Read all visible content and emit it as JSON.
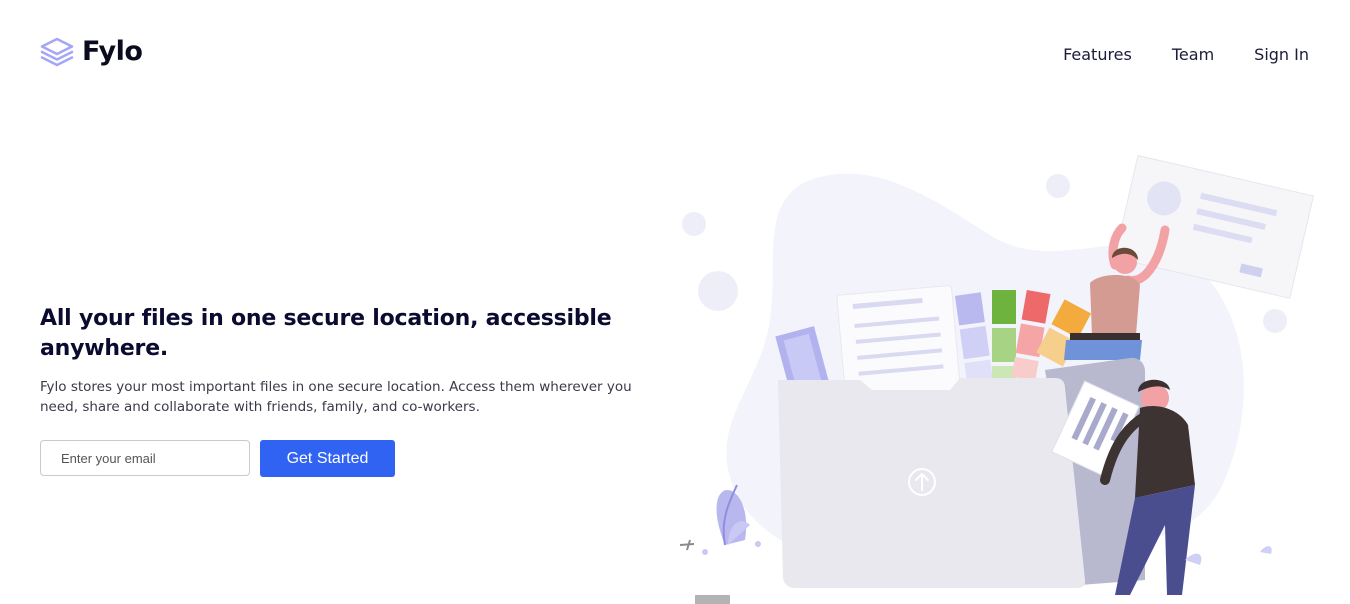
{
  "header": {
    "brand": "Fylo",
    "logo_icon": "stacked-layers-icon",
    "nav": [
      {
        "label": "Features"
      },
      {
        "label": "Team"
      },
      {
        "label": "Sign In"
      }
    ]
  },
  "hero": {
    "title": "All your files in one secure location, accessible anywhere.",
    "description": "Fylo stores your most important files in one secure location. Access them wherever you need, share and collaborate with friends, family, and co-workers."
  },
  "signup": {
    "email_placeholder": "Enter your email",
    "email_value": "",
    "button_label": "Get Started"
  },
  "illustration": {
    "name": "people-with-folder-illustration",
    "folder_icon": "upload-arrow-icon"
  },
  "colors": {
    "brand_dark": "#0b0b30",
    "accent_blue": "#3163f3",
    "logo_purple": "#a5a6f6",
    "blob": "#f3f3fb"
  }
}
